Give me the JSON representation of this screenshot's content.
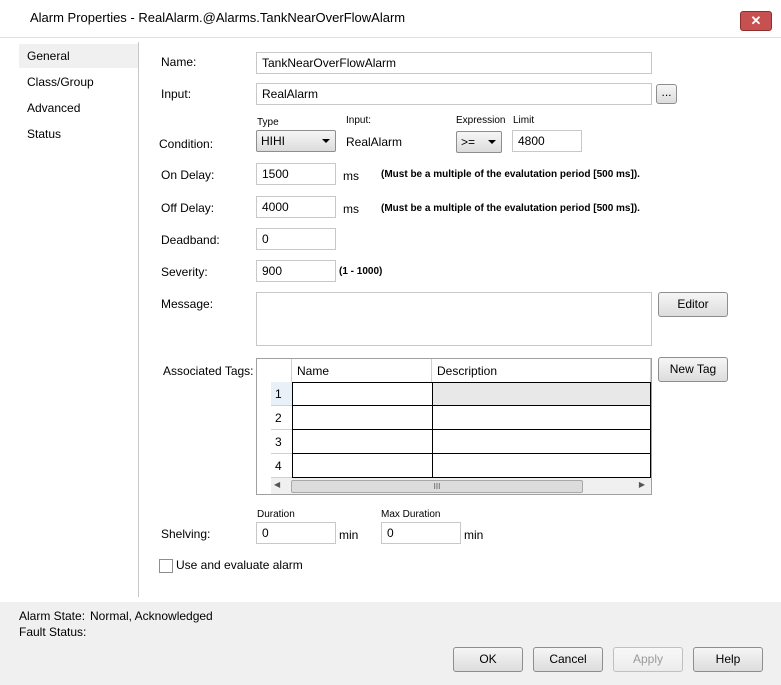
{
  "window": {
    "title": "Alarm Properties - RealAlarm.@Alarms.TankNearOverFlowAlarm",
    "close_glyph": "✕"
  },
  "nav": {
    "items": [
      {
        "label": "General"
      },
      {
        "label": "Class/Group"
      },
      {
        "label": "Advanced"
      },
      {
        "label": "Status"
      }
    ]
  },
  "form": {
    "name_label": "Name:",
    "name_value": "TankNearOverFlowAlarm",
    "input_label": "Input:",
    "input_value": "RealAlarm",
    "browse_label": "...",
    "condition_label": "Condition:",
    "type_label": "Type",
    "type_value": "HIHI",
    "input_col_label": "Input:",
    "input_col_value": "RealAlarm",
    "expression_label": "Expression",
    "expression_value": ">=",
    "limit_label": "Limit",
    "limit_value": "4800",
    "on_delay_label": "On Delay:",
    "on_delay_value": "1500",
    "on_delay_unit": "ms",
    "on_delay_note": "(Must be a multiple of the evalutation period [500 ms]).",
    "off_delay_label": "Off Delay:",
    "off_delay_value": "4000",
    "off_delay_unit": "ms",
    "off_delay_note": "(Must be a multiple of the evalutation period [500 ms]).",
    "deadband_label": "Deadband:",
    "deadband_value": "0",
    "severity_label": "Severity:",
    "severity_value": "900",
    "severity_range": "(1 - 1000)",
    "message_label": "Message:",
    "message_value": "",
    "editor_label": "Editor",
    "associated_tags_label": "Associated Tags:",
    "new_tag_label": "New Tag",
    "shelving_label": "Shelving:",
    "duration_label": "Duration",
    "duration_value": "0",
    "duration_unit": "min",
    "max_duration_label": "Max Duration",
    "max_duration_value": "0",
    "max_duration_unit": "min",
    "use_evaluate_label": "Use and evaluate alarm"
  },
  "grid": {
    "columns": [
      "Name",
      "Description"
    ],
    "rows": [
      {
        "num": "1",
        "name": "",
        "description": ""
      },
      {
        "num": "2",
        "name": "",
        "description": ""
      },
      {
        "num": "3",
        "name": "",
        "description": ""
      },
      {
        "num": "4",
        "name": "",
        "description": ""
      }
    ],
    "scroll_left": "◀",
    "scroll_right": "▶",
    "scroll_grip": "III"
  },
  "status": {
    "alarm_state_label": "Alarm State:",
    "alarm_state_value": "Normal, Acknowledged",
    "fault_status_label": "Fault Status:"
  },
  "buttons": {
    "ok": "OK",
    "cancel": "Cancel",
    "apply": "Apply",
    "help": "Help"
  },
  "colors": {
    "close_red": "#c75050",
    "panel_gray": "#f0f0f0"
  }
}
